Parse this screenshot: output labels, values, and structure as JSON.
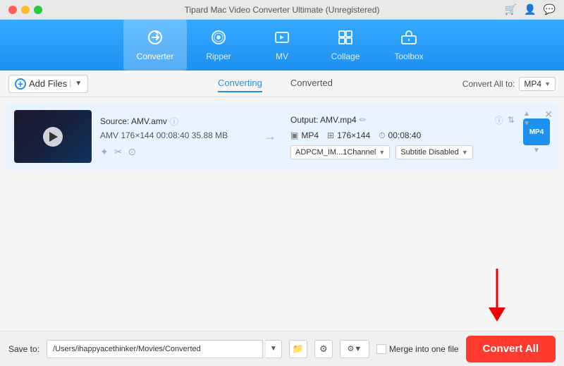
{
  "titleBar": {
    "title": "Tipard Mac Video Converter Ultimate (Unregistered)"
  },
  "nav": {
    "items": [
      {
        "id": "converter",
        "label": "Converter",
        "active": true
      },
      {
        "id": "ripper",
        "label": "Ripper",
        "active": false
      },
      {
        "id": "mv",
        "label": "MV",
        "active": false
      },
      {
        "id": "collage",
        "label": "Collage",
        "active": false
      },
      {
        "id": "toolbox",
        "label": "Toolbox",
        "active": false
      }
    ]
  },
  "toolbar": {
    "addFiles": "Add Files",
    "tabs": [
      {
        "id": "converting",
        "label": "Converting",
        "active": true
      },
      {
        "id": "converted",
        "label": "Converted",
        "active": false
      }
    ],
    "convertAllTo": "Convert All to:",
    "selectedFormat": "MP4"
  },
  "fileItem": {
    "source": "Source: AMV.amv",
    "meta": "AMV  176×144  00:08:40  35.88 MB",
    "output": "Output: AMV.mp4",
    "outputFormat": "MP4",
    "outputResolution": "176×144",
    "outputDuration": "00:08:40",
    "audioChannel": "ADPCM_IM...1Channel",
    "subtitle": "Subtitle Disabled"
  },
  "bottomBar": {
    "saveLabel": "Save to:",
    "savePath": "/Users/ihappyacethinker/Movies/Converted",
    "mergeLabel": "Merge into one file",
    "convertAllLabel": "Convert All"
  },
  "icons": {
    "play": "▶",
    "plus": "+",
    "chevronDown": "▼",
    "chevronUp": "▲",
    "arrowRight": "→",
    "close": "✕",
    "edit": "✏",
    "info": "ⓘ",
    "folder": "📁",
    "settings": "⚙",
    "star": "✦",
    "scissors": "✂",
    "palette": "🎨"
  }
}
